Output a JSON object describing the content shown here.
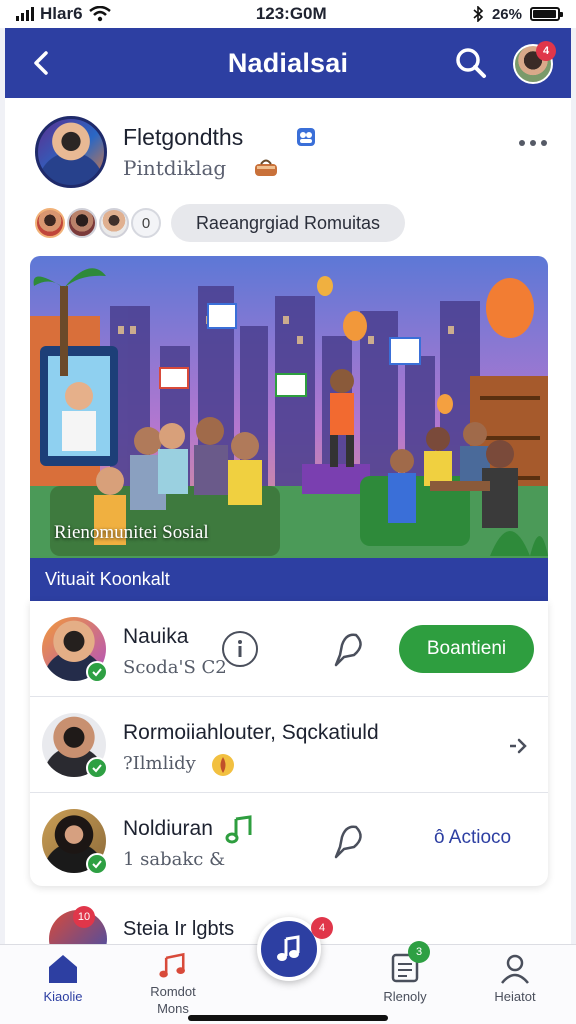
{
  "status_bar": {
    "carrier": "Hlar6",
    "time": "123:G0M",
    "battery_text": "26%",
    "battery_level": 0.9
  },
  "header": {
    "title": "Nadialsai",
    "avatar_badge": "4"
  },
  "post": {
    "author": "Fletgondths",
    "subtitle": "Pintdiklag",
    "participant_count": "0",
    "tag": "Raeangrgiad Romuitas",
    "hero_caption": "Rienomunitei Sosial",
    "hero_bar": "Vituait Koonkalt"
  },
  "list": [
    {
      "title": "Nauika",
      "subtitle": "Scoda'S C2",
      "button": "Boantieni"
    },
    {
      "title": "Rormoiiahlouter, Sqckatiuld",
      "subtitle": "?Ilmlidy"
    },
    {
      "title": "Noldiuran",
      "subtitle": "1 sabakc &",
      "link": "ô Actioco"
    }
  ],
  "peek": {
    "title": "Steia Ir lgbts",
    "badge": "10"
  },
  "nav": {
    "home": "Kiaolie",
    "second_line1": "Romdot",
    "second_line2": "Mons",
    "fab_badge": "4",
    "fourth": "Rlenoly",
    "fourth_badge": "3",
    "profile": "Heiatot"
  },
  "icons": {
    "back": "chevron-left-icon",
    "search": "search-icon",
    "more": "more-horizontal-icon",
    "info": "info-icon",
    "pin": "pin-icon",
    "music": "music-note-icon",
    "home": "home-icon",
    "profile": "user-icon",
    "doc": "document-icon",
    "verified": "check-icon"
  },
  "colors": {
    "primary": "#2d3fa2",
    "success": "#2e9e3f",
    "alert": "#e0364a"
  }
}
